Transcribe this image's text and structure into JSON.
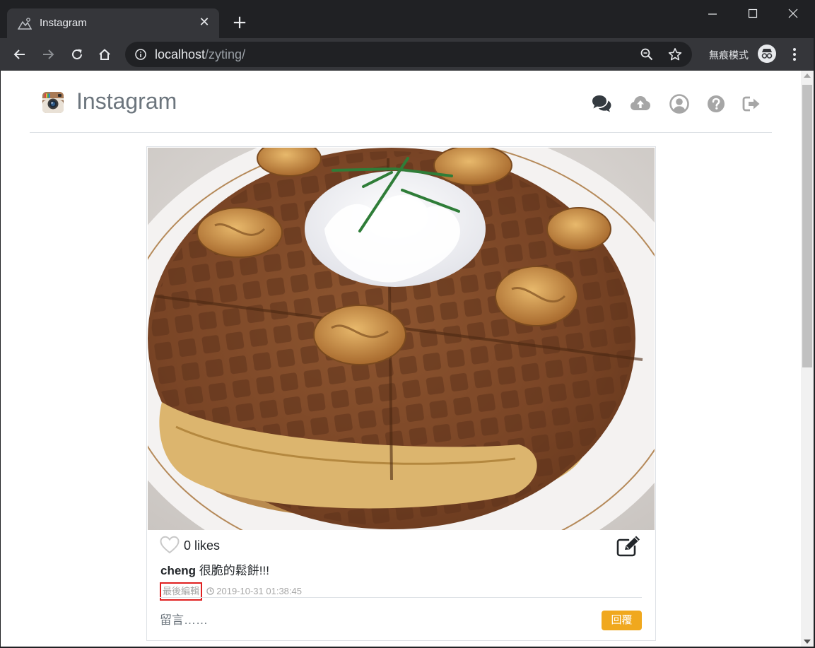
{
  "browser": {
    "tab_title": "Instagram",
    "tab_close": "✕",
    "new_tab": "+",
    "url_host": "localhost",
    "url_path": "/zyting/",
    "incognito_label": "無痕模式",
    "icons": [
      "back-icon",
      "forward-icon",
      "reload-icon",
      "home-icon",
      "info-icon",
      "zoom-icon",
      "star-icon",
      "incognito-icon",
      "menu-icon",
      "minimize-icon",
      "maximize-icon",
      "close-icon"
    ]
  },
  "header": {
    "brand": "Instagram",
    "icons": [
      "chat-icon",
      "upload-icon",
      "profile-icon",
      "help-icon",
      "logout-icon"
    ]
  },
  "post": {
    "likes": "0 likes",
    "username": "cheng",
    "caption": "很脆的鬆餅!!!",
    "edited_label": "最後編輯",
    "timestamp": "2019-10-31 01:38:45",
    "comment_placeholder": "留言……",
    "reply_label": "回覆"
  },
  "colors": {
    "reply_button": "#f0a81e",
    "edited_highlight": "#e02020",
    "brand_text": "#6c757d"
  }
}
